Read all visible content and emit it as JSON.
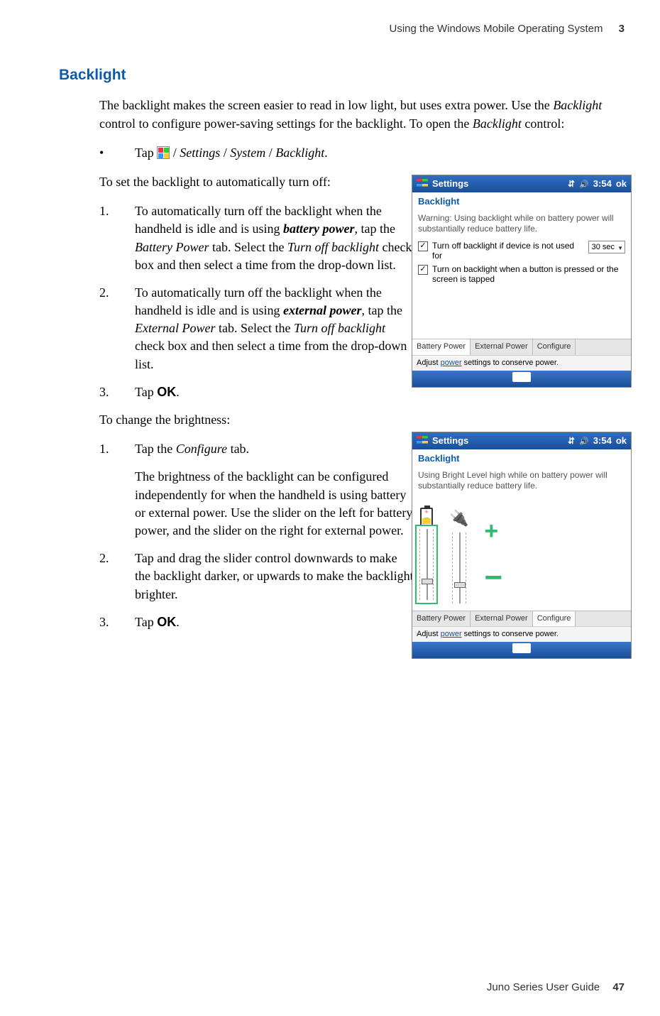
{
  "header": {
    "chapter_title": "Using the Windows Mobile Operating System",
    "chapter_number": "3"
  },
  "section": {
    "title": "Backlight"
  },
  "intro": {
    "p1_a": "The backlight makes the screen easier to read in low light, but uses extra power. Use the ",
    "p1_b": "Backlight",
    "p1_c": " control to configure power-saving settings for the backlight. To open the ",
    "p1_d": "Backlight",
    "p1_e": " control:"
  },
  "bullet": {
    "tap": "Tap ",
    "path_a": " / ",
    "path_settings": "Settings",
    "path_b": " / ",
    "path_system": "System",
    "path_c": " / ",
    "path_backlight": "Backlight",
    "period": "."
  },
  "auto_off": {
    "lead": "To set the backlight to automatically turn off:",
    "s1_a": "To automatically turn off the backlight when the handheld is idle and is using ",
    "s1_b": "battery power",
    "s1_c": ", tap the ",
    "s1_d": "Battery Power",
    "s1_e": " tab. Select the ",
    "s1_f": "Turn off backlight",
    "s1_g": " check box and then select a time from the drop-down list.",
    "s2_a": "To automatically turn off the backlight when the handheld is idle and is using ",
    "s2_b": "external power",
    "s2_c": ", tap the ",
    "s2_d": "External Power",
    "s2_e": " tab. Select the ",
    "s2_f": "Turn off backlight",
    "s2_g": " check box and then select a time from the drop-down list.",
    "s3_a": "Tap ",
    "s3_b": "OK",
    "s3_c": "."
  },
  "brightness": {
    "lead": "To change the brightness:",
    "s1_a": "Tap the ",
    "s1_b": "Configure",
    "s1_c": " tab.",
    "s1_desc": "The brightness of the backlight can be configured independently for when the handheld is using battery or external power. Use the slider on the left for battery power, and the slider on the right for external power.",
    "s2": "Tap and drag the slider control downwards to make the backlight darker, or upwards to make the backlight brighter.",
    "s3_a": "Tap ",
    "s3_b": "OK",
    "s3_c": "."
  },
  "list": {
    "n1": "1.",
    "n2": "2.",
    "n3": "3.",
    "bullet": "•"
  },
  "shot1": {
    "title": "Settings",
    "time": "3:54",
    "ok": "ok",
    "sub": "Backlight",
    "warn": "Warning: Using backlight while on battery power will substantially reduce battery life.",
    "chk1": "Turn off backlight if device is not used for",
    "dd": "30 sec",
    "chk2": "Turn on backlight when a button is pressed or the screen is tapped",
    "tabs": {
      "t1": "Battery Power",
      "t2": "External Power",
      "t3": "Configure"
    },
    "power_a": "Adjust ",
    "power_link": "power",
    "power_b": " settings to conserve power."
  },
  "shot2": {
    "title": "Settings",
    "time": "3:54",
    "ok": "ok",
    "sub": "Backlight",
    "warn": "Using Bright Level high while on battery power will substantially reduce battery life.",
    "tabs": {
      "t1": "Battery Power",
      "t2": "External Power",
      "t3": "Configure"
    },
    "power_a": "Adjust ",
    "power_link": "power",
    "power_b": " settings to conserve power."
  },
  "footer": {
    "guide": "Juno Series User Guide",
    "page": "47"
  }
}
